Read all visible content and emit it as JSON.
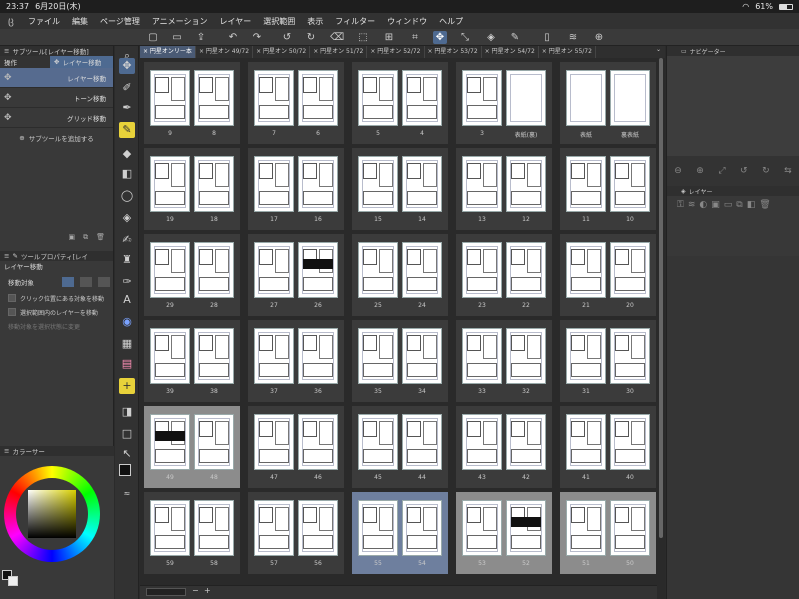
{
  "status": {
    "time": "23:37",
    "date": "6月20日(木)",
    "battery": "61%",
    "battery_level": 0.61
  },
  "menu": [
    "ファイル",
    "編集",
    "ページ管理",
    "アニメーション",
    "レイヤー",
    "選択範囲",
    "表示",
    "フィルター",
    "ウィンドウ",
    "ヘルプ"
  ],
  "subtool": {
    "title": "サブツール[レイヤー移動]",
    "op_label": "操作",
    "op_selected": "レイヤー移動",
    "items": [
      "レイヤー移動",
      "トーン移動",
      "グリッド移動"
    ],
    "add_label": "サブツールを追加する"
  },
  "toolprop": {
    "title": "ツールプロパティ[レイ",
    "name": "レイヤー移動",
    "move_target_label": "移動対象",
    "options": [
      "クリック位置にある対象を移動",
      "選択範囲内のレイヤーを移動",
      "移動対象を選択状態に変更"
    ]
  },
  "color_panel": {
    "title": "カラーサー"
  },
  "tabs": [
    "× 円星オンリー本",
    "× 円星オン 49/72",
    "× 円星オン 50/72",
    "× 円星オン 51/72",
    "× 円星オン 52/72",
    "× 円星オン 53/72",
    "× 円星オン 54/72",
    "× 円星オン 55/72"
  ],
  "navigator": {
    "title": "ナビゲーター"
  },
  "layer_panel": {
    "title": "レイヤー"
  },
  "spreads": [
    {
      "left": "9",
      "right": "8"
    },
    {
      "left": "7",
      "right": "6"
    },
    {
      "left": "5",
      "right": "4"
    },
    {
      "left": "3",
      "right": "表紙(裏)"
    },
    {
      "left": "表紙",
      "right": "裏表紙"
    },
    {
      "left": "19",
      "right": "18"
    },
    {
      "left": "17",
      "right": "16"
    },
    {
      "left": "15",
      "right": "14"
    },
    {
      "left": "13",
      "right": "12"
    },
    {
      "left": "11",
      "right": "10"
    },
    {
      "left": "29",
      "right": "28"
    },
    {
      "left": "27",
      "right": "26"
    },
    {
      "left": "25",
      "right": "24"
    },
    {
      "left": "23",
      "right": "22"
    },
    {
      "left": "21",
      "right": "20"
    },
    {
      "left": "39",
      "right": "38"
    },
    {
      "left": "37",
      "right": "36"
    },
    {
      "left": "35",
      "right": "34"
    },
    {
      "left": "33",
      "right": "32"
    },
    {
      "left": "31",
      "right": "30"
    },
    {
      "left": "49",
      "right": "48"
    },
    {
      "left": "47",
      "right": "46"
    },
    {
      "left": "45",
      "right": "44"
    },
    {
      "left": "43",
      "right": "42"
    },
    {
      "left": "41",
      "right": "40"
    },
    {
      "left": "59",
      "right": "58"
    },
    {
      "left": "57",
      "right": "56"
    },
    {
      "left": "55",
      "right": "54"
    },
    {
      "left": "53",
      "right": "52"
    },
    {
      "left": "51",
      "right": "50"
    }
  ]
}
